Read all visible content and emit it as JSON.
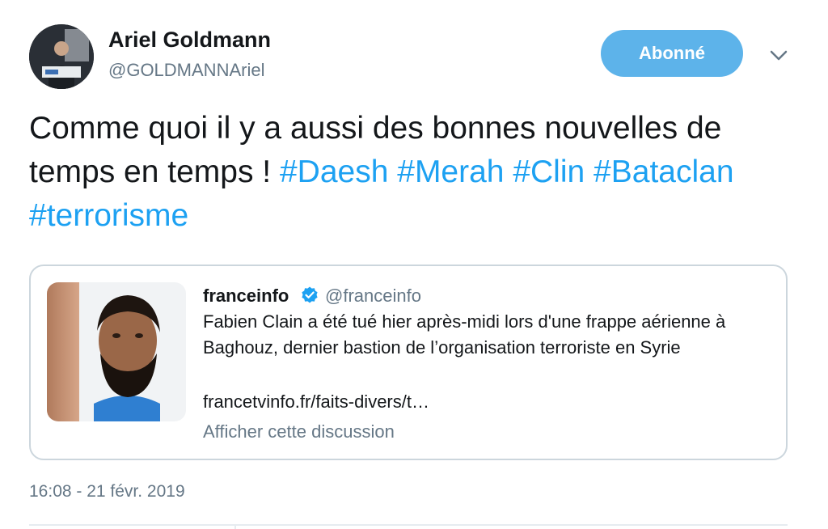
{
  "author": {
    "name": "Ariel Goldmann",
    "handle": "@GOLDMANNAriel"
  },
  "follow_button": {
    "label": "Abonné"
  },
  "tweet": {
    "text_plain": "Comme quoi il y a aussi des bonnes nouvelles de temps en temps ! ",
    "hashtags": [
      "#Daesh",
      "#Merah",
      "#Clin",
      "#Bataclan",
      "#terrorisme"
    ]
  },
  "quote": {
    "name": "franceinfo",
    "handle": "@franceinfo",
    "text": "Fabien Clain a été tué hier après-midi lors d'une frappe aérienne à Baghouz, dernier bastion de l’organisation terroriste en Syrie",
    "link": "francetvinfo.fr/faits-divers/t…",
    "discussion_label": "Afficher cette discussion"
  },
  "timestamp": "16:08 - 21 févr. 2019",
  "icons": {
    "verified": "verified-badge-icon",
    "more": "chevron-down-icon"
  },
  "colors": {
    "accent": "#1da1f2",
    "follow_bg": "#5db3ea",
    "secondary_text": "#657786",
    "border": "#ccd6dd"
  }
}
